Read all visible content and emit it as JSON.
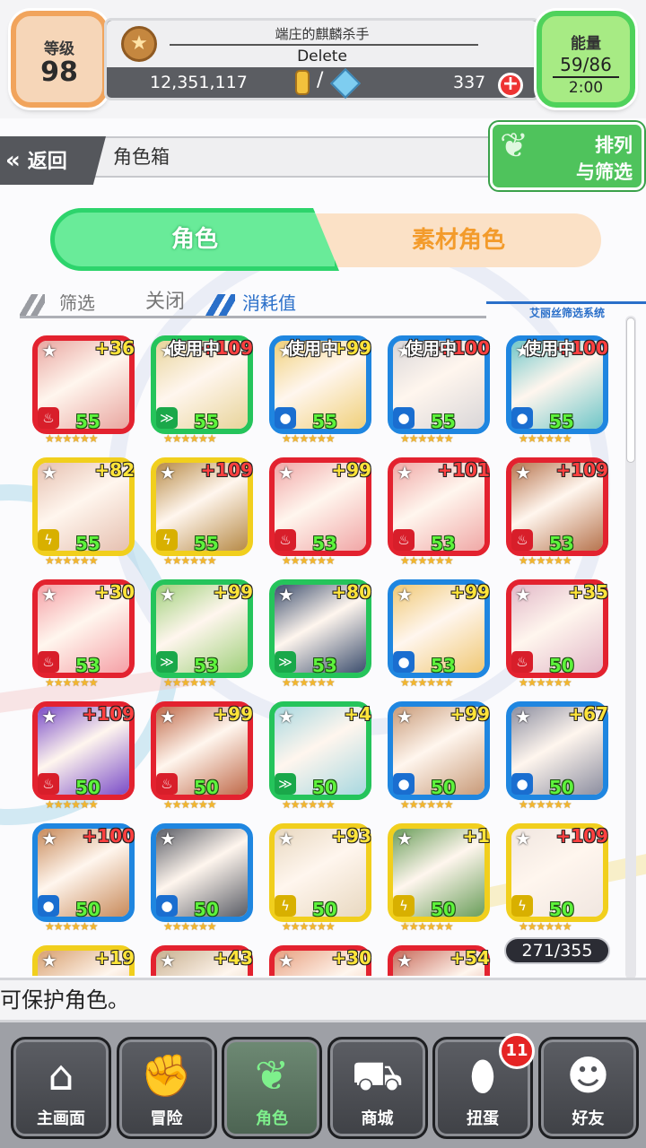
{
  "header": {
    "level_label": "等级",
    "level_value": "98",
    "title": "端庄的麒麟杀手",
    "player_name": "Delete",
    "coins": "12,351,117",
    "slash": "/",
    "gems": "337",
    "energy_label": "能量",
    "energy_value": "59/86",
    "energy_timer": "2:00"
  },
  "nav": {
    "back_label": "返回",
    "breadcrumb": "角色箱",
    "sort_label_1": "排列",
    "sort_label_2": "与筛选"
  },
  "tabs": {
    "characters": "角色",
    "materials": "素材角色"
  },
  "filter": {
    "filter_label": "筛选",
    "filter_state": "关闭",
    "cost_label": "消耗值",
    "system_label": "艾丽丝筛选系统"
  },
  "cards": [
    {
      "frame": "#e3222f",
      "plus": "+36",
      "inuse": "",
      "elem": "fire",
      "level": "55",
      "art": "#e9a6a0"
    },
    {
      "frame": "#25c45b",
      "plus": "+109",
      "inuse": "使用中",
      "elem": "wind",
      "level": "55",
      "art": "#e8d49a"
    },
    {
      "frame": "#1f86e0",
      "plus": "+99",
      "inuse": "使用中",
      "elem": "water",
      "level": "55",
      "art": "#f0d07a"
    },
    {
      "frame": "#1f86e0",
      "plus": "+100",
      "inuse": "使用中",
      "elem": "water",
      "level": "55",
      "art": "#d9d6d8"
    },
    {
      "frame": "#1f86e0",
      "plus": "+100",
      "inuse": "使用中",
      "elem": "water",
      "level": "55",
      "art": "#6fc6c8"
    },
    {
      "frame": "#f1cf1d",
      "plus": "+82",
      "inuse": "",
      "elem": "thunder",
      "level": "55",
      "art": "#e6c0b0"
    },
    {
      "frame": "#f1cf1d",
      "plus": "+109",
      "inuse": "",
      "elem": "thunder",
      "level": "55",
      "art": "#b78a46"
    },
    {
      "frame": "#e3222f",
      "plus": "+99",
      "inuse": "",
      "elem": "fire",
      "level": "53",
      "art": "#f1a6a6"
    },
    {
      "frame": "#e3222f",
      "plus": "+101",
      "inuse": "",
      "elem": "fire",
      "level": "53",
      "art": "#f0a8a6"
    },
    {
      "frame": "#e3222f",
      "plus": "+109",
      "inuse": "",
      "elem": "fire",
      "level": "53",
      "art": "#b7744e"
    },
    {
      "frame": "#e3222f",
      "plus": "+30",
      "inuse": "",
      "elem": "fire",
      "level": "53",
      "art": "#f5a0a6"
    },
    {
      "frame": "#25c45b",
      "plus": "+99",
      "inuse": "",
      "elem": "wind",
      "level": "53",
      "art": "#9fd07a"
    },
    {
      "frame": "#25c45b",
      "plus": "+80",
      "inuse": "",
      "elem": "wind",
      "level": "53",
      "art": "#3c4e6e"
    },
    {
      "frame": "#1f86e0",
      "plus": "+99",
      "inuse": "",
      "elem": "water",
      "level": "53",
      "art": "#f0c874"
    },
    {
      "frame": "#e3222f",
      "plus": "+35",
      "inuse": "",
      "elem": "fire",
      "level": "50",
      "art": "#e2b8c8"
    },
    {
      "frame": "#e3222f",
      "plus": "+109",
      "inuse": "",
      "elem": "fire",
      "level": "50",
      "art": "#7a4cc8"
    },
    {
      "frame": "#e3222f",
      "plus": "+99",
      "inuse": "",
      "elem": "fire",
      "level": "50",
      "art": "#c06a4a"
    },
    {
      "frame": "#25c45b",
      "plus": "+4",
      "inuse": "",
      "elem": "wind",
      "level": "50",
      "art": "#a8d8e0"
    },
    {
      "frame": "#1f86e0",
      "plus": "+99",
      "inuse": "",
      "elem": "water",
      "level": "50",
      "art": "#c89a78"
    },
    {
      "frame": "#1f86e0",
      "plus": "+67",
      "inuse": "",
      "elem": "water",
      "level": "50",
      "art": "#8c8ea0"
    },
    {
      "frame": "#1f86e0",
      "plus": "+100",
      "inuse": "",
      "elem": "water",
      "level": "50",
      "art": "#c88a5a"
    },
    {
      "frame": "#1f86e0",
      "plus": "",
      "inuse": "",
      "elem": "water",
      "level": "50",
      "art": "#5a5d66"
    },
    {
      "frame": "#f1cf1d",
      "plus": "+93",
      "inuse": "",
      "elem": "thunder",
      "level": "50",
      "art": "#e8d8c0"
    },
    {
      "frame": "#f1cf1d",
      "plus": "+1",
      "inuse": "",
      "elem": "thunder",
      "level": "50",
      "art": "#6a9e5a"
    },
    {
      "frame": "#f1cf1d",
      "plus": "+109",
      "inuse": "",
      "elem": "thunder",
      "level": "50",
      "art": "#f0e6e0"
    },
    {
      "frame": "#f1cf1d",
      "plus": "+19",
      "inuse": "",
      "elem": "thunder",
      "level": "",
      "art": "#d8a070"
    },
    {
      "frame": "#e3222f",
      "plus": "+43",
      "inuse": "",
      "elem": "fire",
      "level": "",
      "art": "#c8b090"
    },
    {
      "frame": "#e3222f",
      "plus": "+30",
      "inuse": "",
      "elem": "fire",
      "level": "",
      "art": "#e8a080"
    },
    {
      "frame": "#e3222f",
      "plus": "+54",
      "inuse": "",
      "elem": "fire",
      "level": "",
      "art": "#c86a5a"
    }
  ],
  "elements": {
    "fire": {
      "icon": "fire-icon",
      "glyph": "♨",
      "color": "#d81e2a"
    },
    "water": {
      "icon": "water-drop-icon",
      "glyph": "●",
      "color": "#1a6ed0"
    },
    "wind": {
      "icon": "wind-icon",
      "glyph": "≫",
      "color": "#1aa84a"
    },
    "thunder": {
      "icon": "thunder-icon",
      "glyph": "ϟ",
      "color": "#d8b000"
    }
  },
  "star_rating": "★★★★★★",
  "star_glyph": "★",
  "box_count": "271/355",
  "hint": "可保护角色。",
  "bottom_nav": [
    {
      "name": "nav-home",
      "label": "主画面",
      "icon": "home-icon",
      "glyph": "⌂"
    },
    {
      "name": "nav-adventure",
      "label": "冒险",
      "icon": "handshake-icon",
      "glyph": "✊"
    },
    {
      "name": "nav-characters",
      "label": "角色",
      "icon": "rabbit-icon",
      "glyph": "❦"
    },
    {
      "name": "nav-shop",
      "label": "商城",
      "icon": "cart-icon",
      "glyph": "⛟"
    },
    {
      "name": "nav-gacha",
      "label": "扭蛋",
      "icon": "egg-icon",
      "glyph": "⬮"
    },
    {
      "name": "nav-friends",
      "label": "好友",
      "icon": "friends-icon",
      "glyph": "☻"
    }
  ],
  "gacha_badge": "11",
  "colors": {
    "accent_green": "#4fc35c",
    "accent_orange": "#f39b2b",
    "accent_blue": "#2a6fc9"
  }
}
